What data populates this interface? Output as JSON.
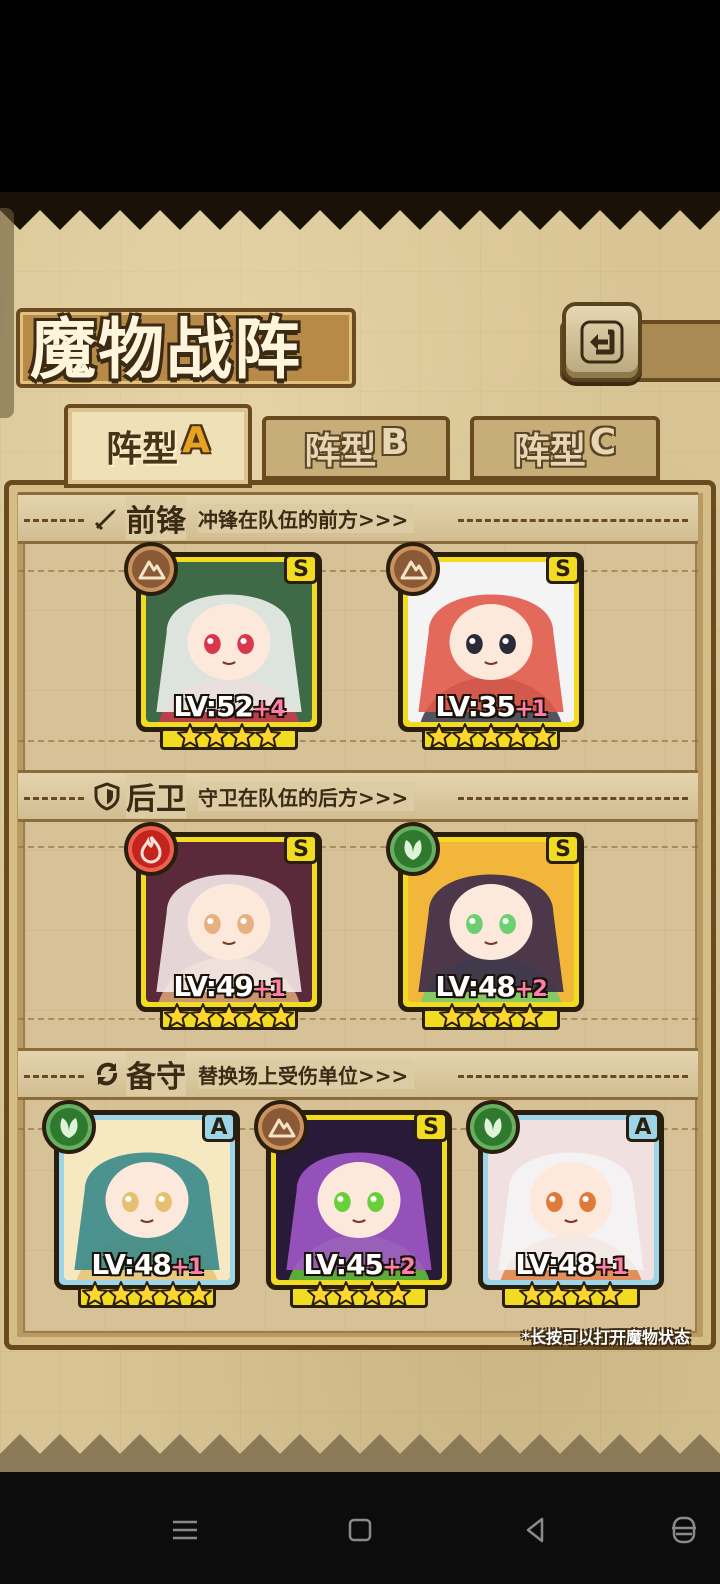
{
  "title": "魔物战阵",
  "tabs": [
    {
      "label_cn": "阵型",
      "label_letter": "A",
      "active": true
    },
    {
      "label_cn": "阵型",
      "label_letter": "B",
      "active": false
    },
    {
      "label_cn": "阵型",
      "label_letter": "C",
      "active": false
    }
  ],
  "sections": {
    "front": {
      "title": "前锋",
      "subtitle": "冲锋在队伍的前方>>>",
      "icon": "sword-icon"
    },
    "back": {
      "title": "后卫",
      "subtitle": "守卫在队伍的后方>>>",
      "icon": "shield-icon"
    },
    "reserve": {
      "title": "备守",
      "subtitle": "替换场上受伤单位>>>",
      "icon": "swap-icon"
    }
  },
  "cards": {
    "front": [
      {
        "element": "earth",
        "rank": "S",
        "lv_prefix": "LV:",
        "level": "52",
        "plus": "+4",
        "stars": 4,
        "frame": "gold"
      },
      {
        "element": "earth",
        "rank": "S",
        "lv_prefix": "LV:",
        "level": "35",
        "plus": "+1",
        "stars": 5,
        "frame": "gold"
      }
    ],
    "back": [
      {
        "element": "fire",
        "rank": "S",
        "lv_prefix": "LV:",
        "level": "49",
        "plus": "+1",
        "stars": 5,
        "frame": "gold"
      },
      {
        "element": "wood",
        "rank": "S",
        "lv_prefix": "LV:",
        "level": "48",
        "plus": "+2",
        "stars": 4,
        "frame": "gold"
      }
    ],
    "reserve": [
      {
        "element": "wood",
        "rank": "A",
        "lv_prefix": "LV:",
        "level": "48",
        "plus": "+1",
        "stars": 5,
        "frame": "cyan"
      },
      {
        "element": "earth",
        "rank": "S",
        "lv_prefix": "LV:",
        "level": "45",
        "plus": "+2",
        "stars": 4,
        "frame": "gold"
      },
      {
        "element": "wood",
        "rank": "A",
        "lv_prefix": "LV:",
        "level": "48",
        "plus": "+1",
        "stars": 4,
        "frame": "cyan"
      }
    ]
  },
  "footnote": "*长按可以打开魔物状态",
  "colors": {
    "gold_frame": "#f1dc22",
    "cyan_frame": "#9cd4e8",
    "accent_letter": "#e7a31f",
    "plus_pink": "#ff7fa8"
  },
  "system_nav": [
    "menu-icon",
    "home-square-icon",
    "back-triangle-icon",
    "assistant-icon"
  ]
}
